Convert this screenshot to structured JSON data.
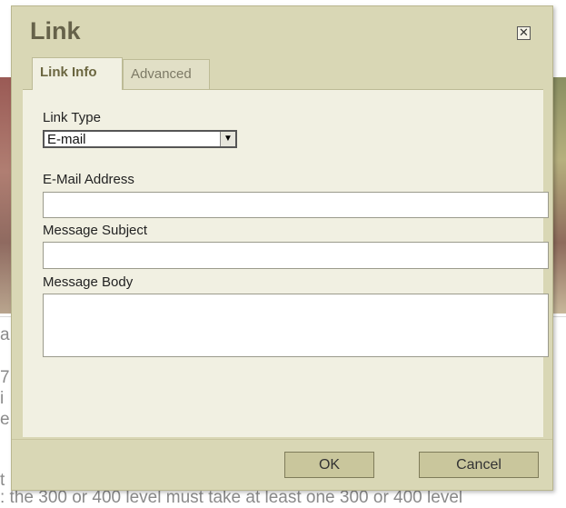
{
  "dialog": {
    "title": "Link",
    "close_icon": "close-icon",
    "tabs": [
      {
        "label": "Link Info",
        "active": true
      },
      {
        "label": "Advanced",
        "active": false
      }
    ],
    "link_type": {
      "label": "Link Type",
      "value": "E-mail"
    },
    "email": {
      "label": "E-Mail Address",
      "value": ""
    },
    "subject": {
      "label": "Message Subject",
      "value": ""
    },
    "body": {
      "label": "Message Body",
      "value": ""
    },
    "buttons": {
      "ok": "OK",
      "cancel": "Cancel"
    }
  },
  "background": {
    "line_1": "a",
    "line_2": "7",
    "line_3": "i",
    "line_4": "e",
    "line_5": "t",
    "bottom_text": ": the 300 or 400 level must take at least one 300 or 400 level"
  }
}
